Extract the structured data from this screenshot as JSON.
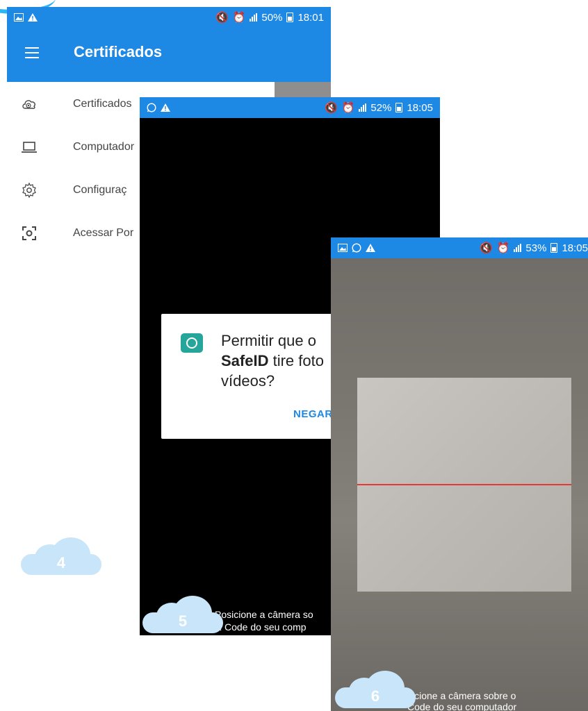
{
  "screen4": {
    "status": {
      "battery": "50%",
      "time": "18:01"
    },
    "app_title": "Certificados",
    "menu": [
      {
        "label": "Certificados",
        "icon": "cloud-fingerprint-icon"
      },
      {
        "label": "Computador",
        "icon": "laptop-icon"
      },
      {
        "label": "Configuraç",
        "icon": "gear-icon"
      },
      {
        "label": "Acessar Por",
        "icon": "qr-scan-icon"
      }
    ],
    "badge": "4"
  },
  "screen5": {
    "status": {
      "battery": "52%",
      "time": "18:05"
    },
    "dialog": {
      "line1": "Permitir que o",
      "app_name": "SafeID",
      "line2_rest": " tire foto",
      "line3": "vídeos?",
      "deny_label": "NEGAR"
    },
    "instruction_line1": "Posicione a câmera so",
    "instruction_line2": "R Code do seu comp",
    "badge": "5"
  },
  "screen6": {
    "status": {
      "battery": "53%",
      "time": "18:05"
    },
    "instruction_line1": "sicione a câmera sobre o",
    "instruction_line2": "Code do seu computador",
    "badge": "6"
  },
  "colors": {
    "primary": "#1e88e5",
    "accent": "#26a69a",
    "scan_line": "#e53935",
    "cloud": "#c9e5fa"
  }
}
